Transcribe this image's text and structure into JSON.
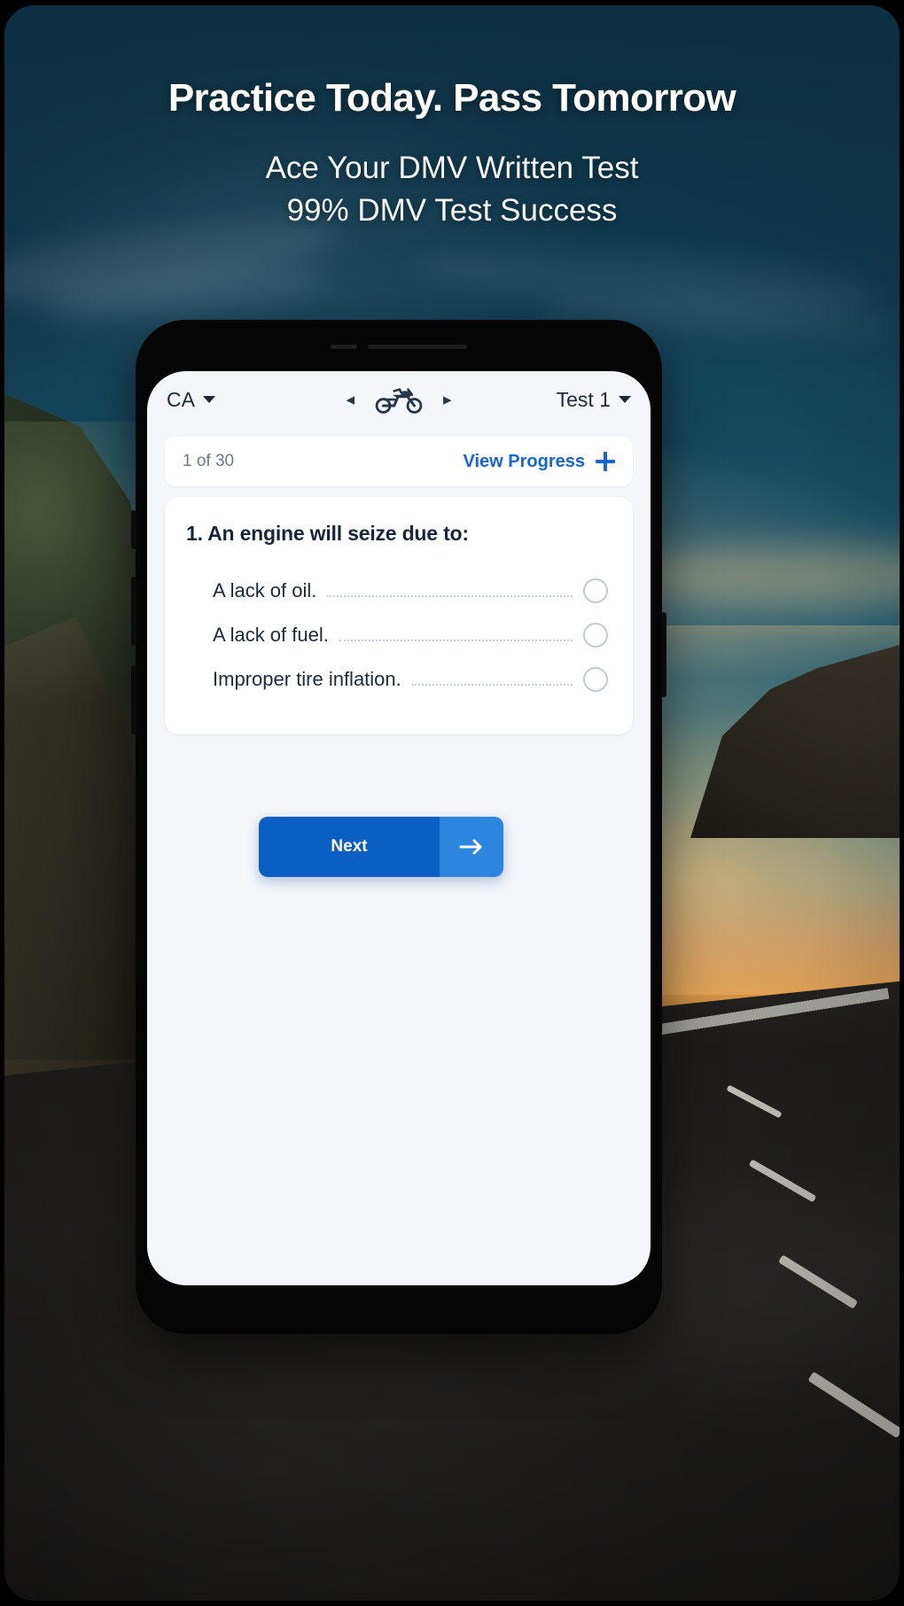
{
  "poster": {
    "headline": "Practice Today. Pass Tomorrow",
    "subline_line1": "Ace Your DMV Written Test",
    "subline_line2": "99% DMV Test Success",
    "accent_blue": "#1565d8",
    "button_blue": "#0a5fc4",
    "button_arrow_blue": "#2c86df",
    "background_top": "#0f3446",
    "text_dark": "#18263a"
  },
  "app": {
    "header": {
      "state_label": "CA",
      "state_caret": "chevron-down-icon",
      "prev_arrow": "◂",
      "vehicle_icon": "motorcycle-icon",
      "next_arrow": "▸",
      "test_label": "Test 1",
      "test_caret": "chevron-down-icon"
    },
    "progress": {
      "count_label": "1 of 30",
      "view_progress_label": "View Progress",
      "plus_icon": "plus-icon"
    },
    "question": {
      "number": "1.",
      "text": "An engine will seize due to:",
      "full_title": "1. An engine will seize due to:",
      "options": [
        {
          "label": "A lack of oil.",
          "selected": false
        },
        {
          "label": "A lack of fuel.",
          "selected": false
        },
        {
          "label": "Improper tire inflation.",
          "selected": false
        }
      ]
    },
    "next_button": {
      "label": "Next",
      "icon": "arrow-right-icon"
    }
  }
}
